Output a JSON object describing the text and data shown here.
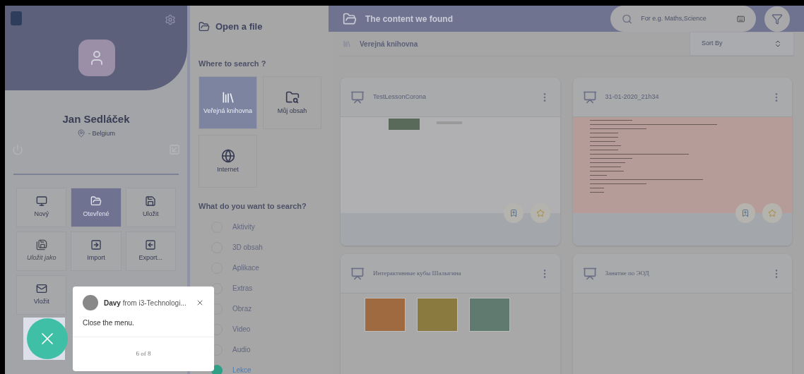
{
  "profile": {
    "name": "Jan Sedláček",
    "location": "- Belgium"
  },
  "menu_tiles": [
    {
      "label": "Nový",
      "kind": "new",
      "selected": false,
      "disabled": false
    },
    {
      "label": "Otevřené",
      "kind": "open",
      "selected": true,
      "disabled": false
    },
    {
      "label": "Uložit",
      "kind": "save",
      "selected": false,
      "disabled": false
    },
    {
      "label": "Uložit jako",
      "kind": "saveas",
      "selected": false,
      "disabled": true
    },
    {
      "label": "Import",
      "kind": "import",
      "selected": false,
      "disabled": false
    },
    {
      "label": "Export...",
      "kind": "export",
      "selected": false,
      "disabled": false
    },
    {
      "label": "Vložit",
      "kind": "insert",
      "selected": false,
      "disabled": false
    }
  ],
  "tour_tooltip": {
    "author": "Davy",
    "from": "from i3-Technologi...",
    "message": "Close the menu.",
    "step": "6 of 8"
  },
  "open_panel": {
    "title": "Open a file",
    "where_heading": "Where to search ?",
    "sources": [
      {
        "label": "Veřejná knihovna",
        "kind": "library",
        "selected": true
      },
      {
        "label": "Můj obsah",
        "kind": "mine",
        "selected": false
      },
      {
        "label": "Internet",
        "kind": "internet",
        "selected": false
      }
    ],
    "what_heading": "What do you want to search?",
    "types": [
      {
        "label": "Aktivity",
        "selected": false
      },
      {
        "label": "3D obsah",
        "selected": false
      },
      {
        "label": "Aplikace",
        "selected": false
      },
      {
        "label": "Extras",
        "selected": false
      },
      {
        "label": "Obraz",
        "selected": false
      },
      {
        "label": "Video",
        "selected": false
      },
      {
        "label": "Audio",
        "selected": false
      },
      {
        "label": "Lekce",
        "selected": true
      }
    ]
  },
  "results": {
    "title": "The content we found",
    "search": {
      "placeholder": "For e.g. Maths,Science"
    },
    "location": "Verejná knihovna",
    "sort": "Sort By",
    "cards": [
      {
        "title": "TestLessonCorona",
        "kind": "slide",
        "serif": false
      },
      {
        "title": "31-01-2020_21h34",
        "kind": "document",
        "serif": false
      },
      {
        "title": "Интерактивные кубы Шалыгина",
        "kind": "cubes",
        "serif": true
      },
      {
        "title": "Занятие по ЭОД",
        "kind": "blank",
        "serif": true
      }
    ]
  }
}
